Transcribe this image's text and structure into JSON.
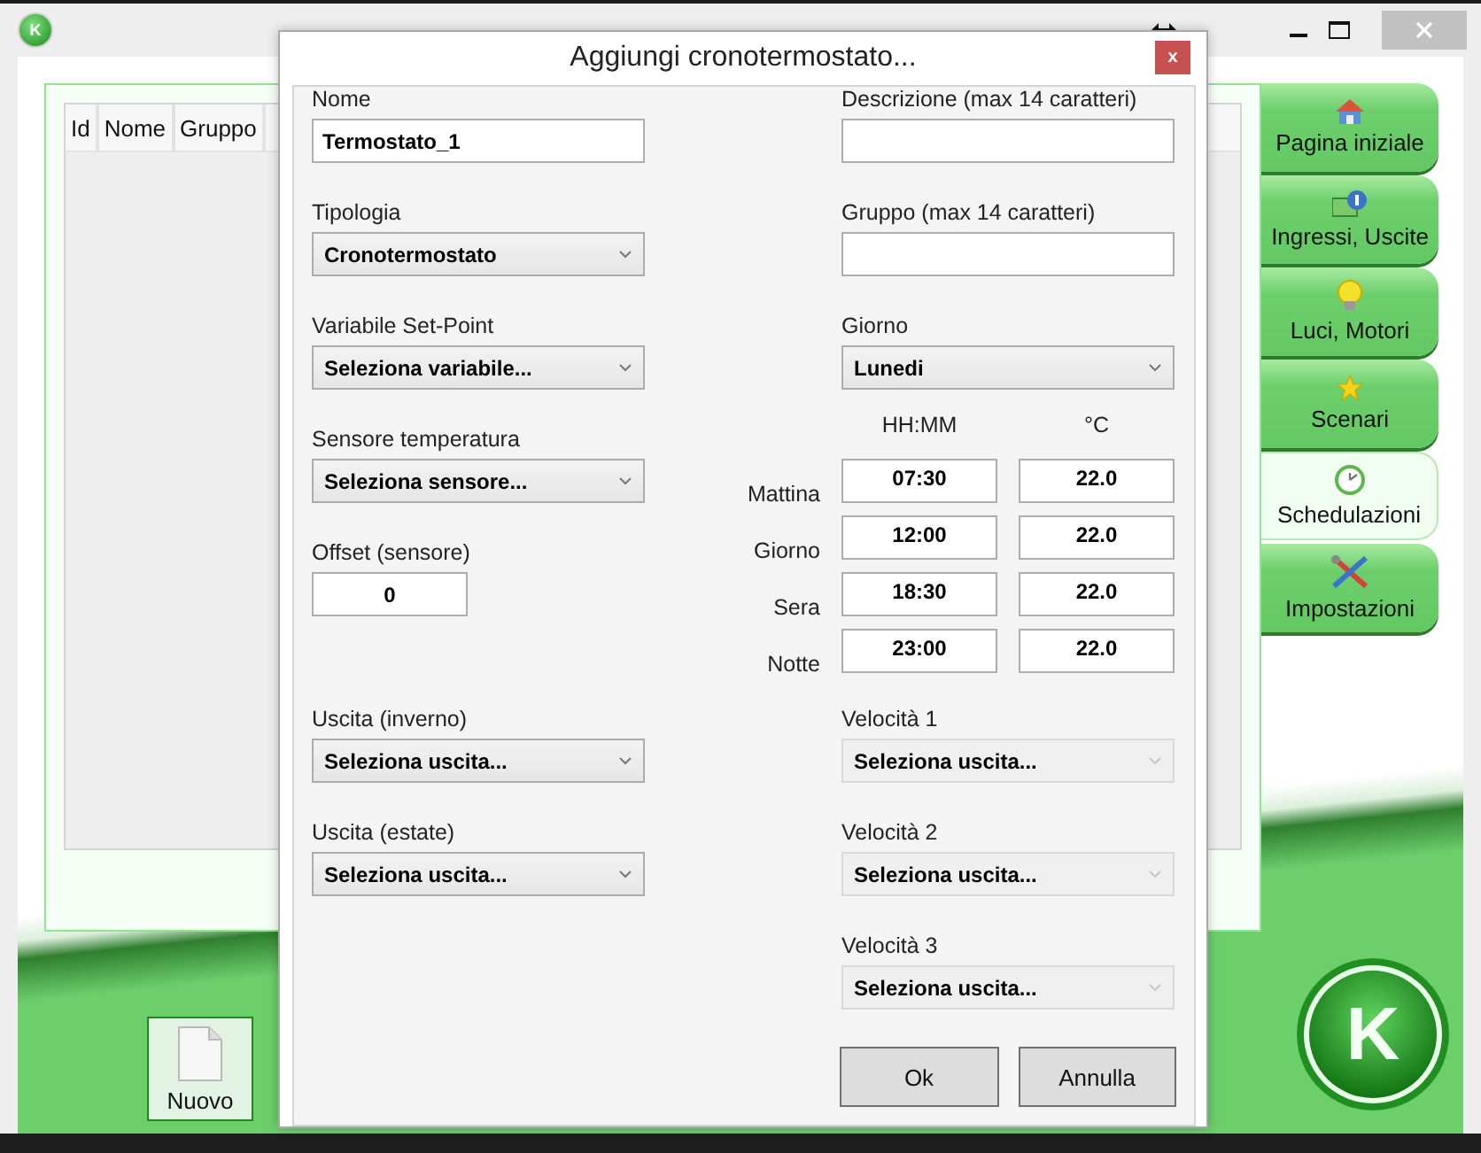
{
  "app": {
    "title_icon": "K",
    "table": {
      "columns": [
        "Id",
        "Nome",
        "Gruppo"
      ]
    },
    "nav": [
      {
        "label": "Pagina iniziale",
        "selected": false
      },
      {
        "label": "Ingressi, Uscite",
        "selected": false
      },
      {
        "label": "Luci, Motori",
        "selected": false
      },
      {
        "label": "Scenari",
        "selected": false
      },
      {
        "label": "Schedulazioni",
        "selected": true
      },
      {
        "label": "Impostazioni",
        "selected": false
      }
    ],
    "toolbar": [
      {
        "label": "Nuovo"
      }
    ],
    "logo": "K"
  },
  "dialog": {
    "title": "Aggiungi cronotermostato...",
    "close": "x",
    "top": {
      "left": [
        {
          "kind": "text",
          "label": "Nome",
          "value": "Termostato_1"
        },
        {
          "kind": "select",
          "label": "Tipologia",
          "value": "Cronotermostato",
          "disabled": false
        },
        {
          "kind": "select",
          "label": "Variabile Set-Point",
          "value": "Seleziona variabile...",
          "disabled": false
        },
        {
          "kind": "select",
          "label": "Sensore temperatura",
          "value": "Seleziona sensore...",
          "disabled": false
        },
        {
          "kind": "number",
          "label": "Offset (sensore)",
          "value": "0"
        }
      ],
      "right": [
        {
          "kind": "text",
          "label": "Descrizione (max 14 caratteri)"
        },
        {
          "kind": "text",
          "label": "Gruppo (max 14 caratteri)"
        },
        {
          "kind": "select",
          "label": "Giorno",
          "value": "Lunedi",
          "disabled": false
        },
        {
          "kind": "schedule",
          "columns": [
            "HH:MM",
            "°C"
          ],
          "rows": [
            {
              "label": "Mattina",
              "time": "07:30",
              "temp": "22.0"
            },
            {
              "label": "Giorno",
              "time": "12:00",
              "temp": "22.0"
            },
            {
              "label": "Sera",
              "time": "18:30",
              "temp": "22.0"
            },
            {
              "label": "Notte",
              "time": "23:00",
              "temp": "22.0"
            }
          ]
        }
      ]
    },
    "bottom": {
      "left": [
        {
          "kind": "select",
          "label": "Uscita (inverno)",
          "value": "Seleziona uscita...",
          "disabled": false
        },
        {
          "kind": "select",
          "label": "Uscita (estate)",
          "value": "Seleziona uscita...",
          "disabled": false
        }
      ],
      "right": [
        {
          "kind": "select",
          "label": "Velocità 1",
          "value": "Seleziona uscita...",
          "disabled": true
        },
        {
          "kind": "select",
          "label": "Velocità 2",
          "value": "Seleziona uscita...",
          "disabled": true
        },
        {
          "kind": "select",
          "label": "Velocità 3",
          "value": "Seleziona uscita...",
          "disabled": true
        }
      ]
    },
    "buttons": [
      "Ok",
      "Annulla"
    ]
  }
}
